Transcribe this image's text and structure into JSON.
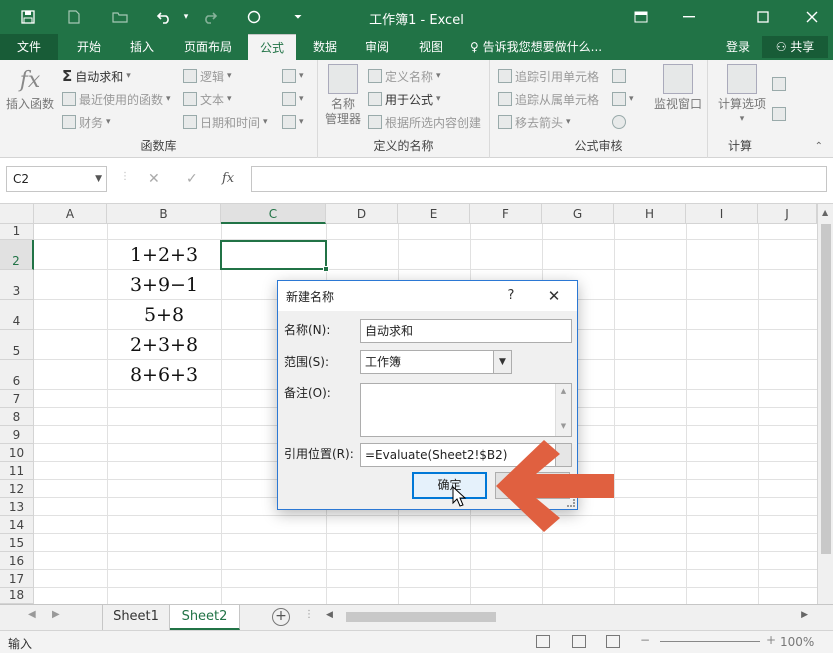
{
  "window": {
    "title": "工作簿1 - Excel",
    "quick_access": [
      "save-icon",
      "new-icon",
      "open-icon",
      "undo-icon",
      "redo-icon",
      "circle-icon",
      "customize-icon"
    ]
  },
  "tabs": {
    "file": "文件",
    "home": "开始",
    "insert": "插入",
    "page_layout": "页面布局",
    "formulas": "公式",
    "data": "数据",
    "review": "审阅",
    "view": "视图",
    "tell_me": "告诉我您想要做什么...",
    "login": "登录",
    "share": "共享"
  },
  "ribbon": {
    "insert_function": "插入函数",
    "autosum": "自动求和",
    "recent": "最近使用的函数",
    "financial": "财务",
    "logical": "逻辑",
    "text": "文本",
    "datetime": "日期和时间",
    "function_library": "函数库",
    "name_manager_1": "名称",
    "name_manager_2": "管理器",
    "define_name": "定义名称",
    "use_in_formula": "用于公式",
    "create_from_selection": "根据所选内容创建",
    "defined_names": "定义的名称",
    "trace_precedents": "追踪引用单元格",
    "trace_dependents": "追踪从属单元格",
    "remove_arrows": "移去箭头",
    "watch_window": "监视窗口",
    "formula_auditing": "公式审核",
    "calc_options": "计算选项",
    "calculation": "计算"
  },
  "formula_bar": {
    "name_box": "C2",
    "fx": "fx",
    "value": ""
  },
  "grid": {
    "columns": [
      "A",
      "B",
      "C",
      "D",
      "E",
      "F",
      "G",
      "H",
      "I",
      "J"
    ],
    "selected_column": "C",
    "rows": [
      "1",
      "2",
      "3",
      "4",
      "5",
      "6",
      "7",
      "8",
      "9",
      "10",
      "11",
      "12",
      "13",
      "14",
      "15",
      "16",
      "17",
      "18"
    ],
    "selected_row": "2",
    "cells_B": [
      "1+2+3",
      "3+9−1",
      "5+8",
      "2+3+8",
      "8+6+3"
    ]
  },
  "sheets": {
    "tabs": [
      "Sheet1",
      "Sheet2"
    ],
    "active": "Sheet2"
  },
  "status": {
    "mode": "输入",
    "zoom": "100%"
  },
  "dialog": {
    "title": "新建名称",
    "help": "?",
    "name_label": "名称(N):",
    "name_value": "自动求和",
    "scope_label": "范围(S):",
    "scope_value": "工作簿",
    "comment_label": "备注(O):",
    "refers_label": "引用位置(R):",
    "refers_value": "=Evaluate(Sheet2!$B2)",
    "ok": "确定"
  },
  "annotation": {
    "arrow_color": "#e06040"
  }
}
